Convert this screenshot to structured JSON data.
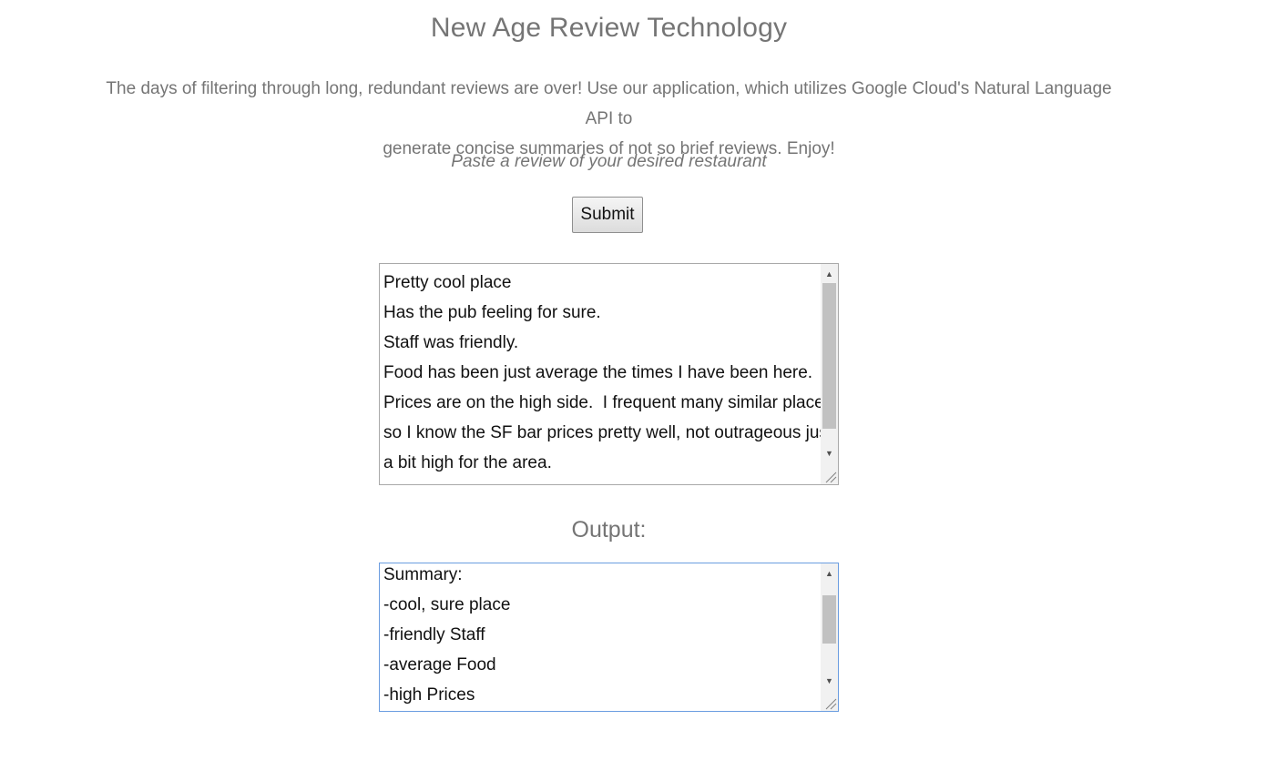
{
  "header": {
    "title": "New Age Review Technology",
    "description_line1": "The days of filtering through long, redundant reviews are over! Use our application, which utilizes Google Cloud's Natural Language API to",
    "description_line2": "generate concise summaries of not so brief reviews. Enjoy!",
    "prompt": "Paste a review of your desired restaurant"
  },
  "form": {
    "submit_label": "Submit"
  },
  "review_input": {
    "lines": [
      "Pretty cool place",
      "Has the pub feeling for sure.",
      "Staff was friendly.",
      "Food has been just average the times I have been here.",
      "Prices are on the high side.  I frequent many similar place",
      "so I know the SF bar prices pretty well, not outrageous just",
      "a bit high for the area."
    ]
  },
  "output": {
    "label": "Output:",
    "lines": [
      "Summary:",
      "-cool, sure place",
      "-friendly Staff",
      "-average Food",
      "-high Prices"
    ]
  },
  "icons": {
    "scroll_up": "scroll-up-arrow-icon",
    "scroll_down": "scroll-down-arrow-icon",
    "resize": "resize-grip-icon"
  },
  "colors": {
    "text_muted": "#757575",
    "focus_border": "#6b9de0"
  }
}
